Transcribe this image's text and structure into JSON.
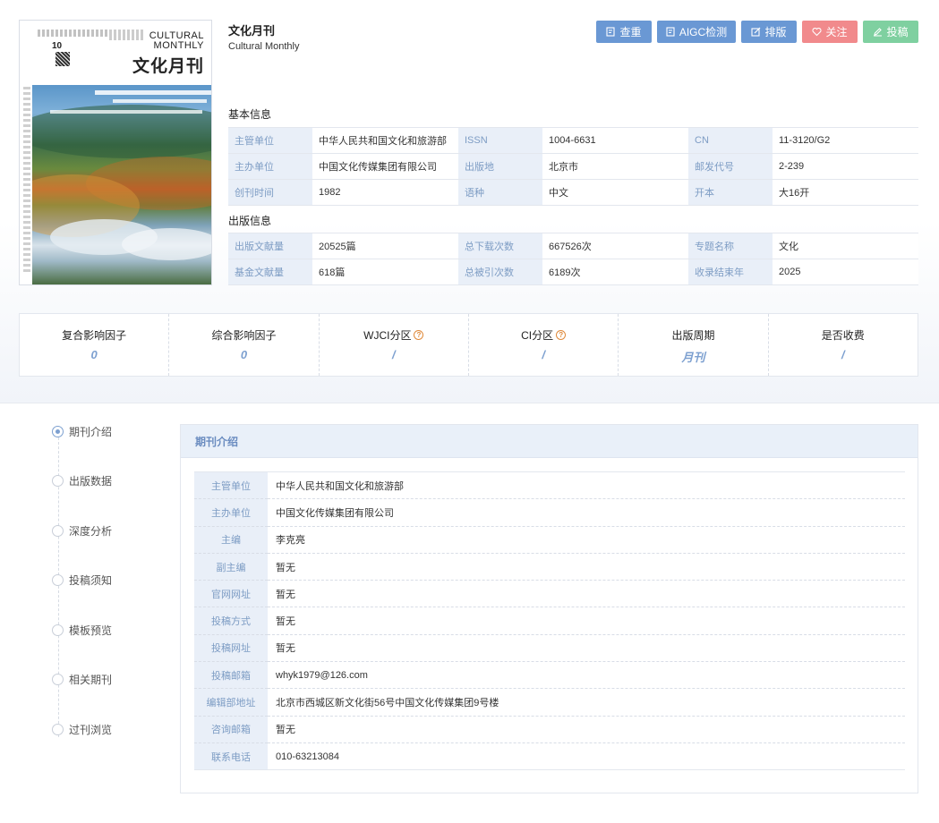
{
  "journal": {
    "title_cn": "文化月刊",
    "title_en": "Cultural Monthly",
    "cover": {
      "issue": "10",
      "english_title_line1": "CULTURAL",
      "english_title_line2": "MONTHLY",
      "chinese_title": "文化月刊"
    }
  },
  "actions": {
    "check": "查重",
    "aigc": "AIGC检测",
    "layout": "排版",
    "follow": "关注",
    "submit": "投稿",
    "colors": {
      "blue": "#6a98d4",
      "red": "#f18a8c",
      "green": "#7fd0a0"
    }
  },
  "basic": {
    "heading": "基本信息",
    "rows": [
      [
        [
          "主管单位",
          "中华人民共和国文化和旅游部"
        ],
        [
          "ISSN",
          "1004-6631"
        ],
        [
          "CN",
          "11-3120/G2"
        ]
      ],
      [
        [
          "主办单位",
          "中国文化传媒集团有限公司"
        ],
        [
          "出版地",
          "北京市"
        ],
        [
          "邮发代号",
          "2-239"
        ]
      ],
      [
        [
          "创刊时间",
          "1982"
        ],
        [
          "语种",
          "中文"
        ],
        [
          "开本",
          "大16开"
        ]
      ]
    ]
  },
  "publishing": {
    "heading": "出版信息",
    "rows": [
      [
        [
          "出版文献量",
          "20525篇"
        ],
        [
          "总下载次数",
          "667526次"
        ],
        [
          "专题名称",
          "文化"
        ]
      ],
      [
        [
          "基金文献量",
          "618篇"
        ],
        [
          "总被引次数",
          "6189次"
        ],
        [
          "收录结束年",
          "2025"
        ]
      ]
    ]
  },
  "metrics": [
    {
      "label": "复合影响因子",
      "value": "0",
      "help": false
    },
    {
      "label": "综合影响因子",
      "value": "0",
      "help": false
    },
    {
      "label": "WJCI分区",
      "value": "/",
      "help": true
    },
    {
      "label": "CI分区",
      "value": "/",
      "help": true
    },
    {
      "label": "出版周期",
      "value": "月刊",
      "help": false
    },
    {
      "label": "是否收费",
      "value": "/",
      "help": false
    }
  ],
  "nav": [
    {
      "label": "期刊介绍",
      "active": true
    },
    {
      "label": "出版数据",
      "active": false
    },
    {
      "label": "深度分析",
      "active": false
    },
    {
      "label": "投稿须知",
      "active": false
    },
    {
      "label": "模板预览",
      "active": false
    },
    {
      "label": "相关期刊",
      "active": false
    },
    {
      "label": "过刊浏览",
      "active": false
    }
  ],
  "intro": {
    "heading": "期刊介绍",
    "rows": [
      [
        "主管单位",
        "中华人民共和国文化和旅游部"
      ],
      [
        "主办单位",
        "中国文化传媒集团有限公司"
      ],
      [
        "主编",
        "李克亮"
      ],
      [
        "副主编",
        "暂无"
      ],
      [
        "官网网址",
        "暂无"
      ],
      [
        "投稿方式",
        "暂无"
      ],
      [
        "投稿网址",
        "暂无"
      ],
      [
        "投稿邮箱",
        "whyk1979@126.com"
      ],
      [
        "编辑部地址",
        "北京市西城区新文化街56号中国文化传媒集团9号楼"
      ],
      [
        "咨询邮箱",
        "暂无"
      ],
      [
        "联系电话",
        "010-63213084"
      ]
    ]
  }
}
